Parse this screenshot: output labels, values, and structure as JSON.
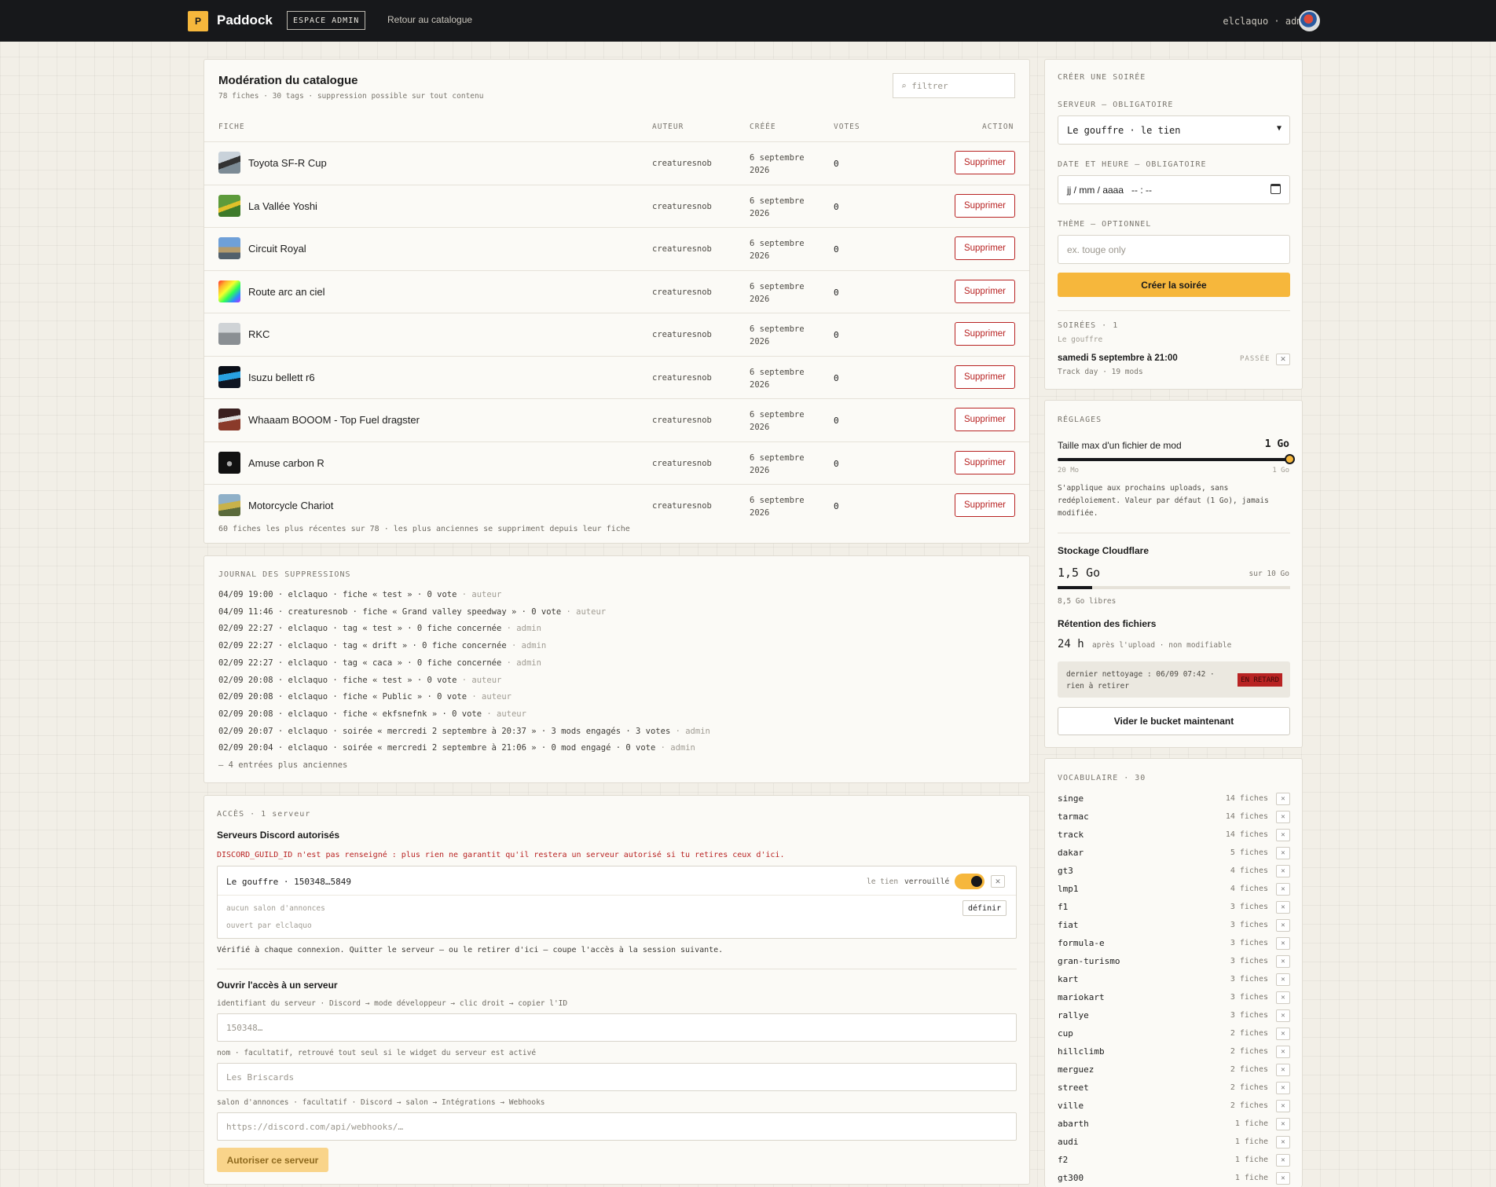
{
  "topbar": {
    "logo_letter": "P",
    "brand": "Paddock",
    "admin_badge": "ESPACE ADMIN",
    "back_link": "Retour au catalogue",
    "user": "elclaquo · admin"
  },
  "moderation": {
    "title": "Modération du catalogue",
    "subtitle": "78 fiches · 30 tags · suppression possible sur tout contenu",
    "filter_placeholder": "⌕ filtrer",
    "headers": {
      "fiche": "FICHE",
      "auteur": "AUTEUR",
      "creee": "CRÉÉE",
      "votes": "VOTES",
      "action": "ACTION"
    },
    "delete_label": "Supprimer",
    "rows": [
      {
        "name": "Toyota SF-R Cup",
        "author": "creaturesnob",
        "date1": "6 septembre",
        "date2": "2026",
        "votes": "0"
      },
      {
        "name": "La Vallée Yoshi",
        "author": "creaturesnob",
        "date1": "6 septembre",
        "date2": "2026",
        "votes": "0"
      },
      {
        "name": "Circuit Royal",
        "author": "creaturesnob",
        "date1": "6 septembre",
        "date2": "2026",
        "votes": "0"
      },
      {
        "name": "Route arc an ciel",
        "author": "creaturesnob",
        "date1": "6 septembre",
        "date2": "2026",
        "votes": "0"
      },
      {
        "name": "RKC",
        "author": "creaturesnob",
        "date1": "6 septembre",
        "date2": "2026",
        "votes": "0"
      },
      {
        "name": "Isuzu bellett r6",
        "author": "creaturesnob",
        "date1": "6 septembre",
        "date2": "2026",
        "votes": "0"
      },
      {
        "name": "Whaaam BOOOM - Top Fuel dragster",
        "author": "creaturesnob",
        "date1": "6 septembre",
        "date2": "2026",
        "votes": "0"
      },
      {
        "name": "Amuse carbon R",
        "author": "creaturesnob",
        "date1": "6 septembre",
        "date2": "2026",
        "votes": "0"
      },
      {
        "name": "Motorcycle Chariot",
        "author": "creaturesnob",
        "date1": "6 septembre",
        "date2": "2026",
        "votes": "0"
      }
    ],
    "footer": "60 fiches les plus récentes sur 78 · les plus anciennes se suppriment depuis leur fiche"
  },
  "journal": {
    "title": "JOURNAL DES SUPPRESSIONS",
    "entries": [
      {
        "text": "04/09 19:00 · elclaquo · fiche « test » · 0 vote",
        "tag": "· auteur"
      },
      {
        "text": "04/09 11:46 · creaturesnob · fiche « Grand valley speedway » · 0 vote",
        "tag": "· auteur"
      },
      {
        "text": "02/09 22:27 · elclaquo · tag « test » · 0 fiche concernée",
        "tag": "· admin"
      },
      {
        "text": "02/09 22:27 · elclaquo · tag « drift » · 0 fiche concernée",
        "tag": "· admin"
      },
      {
        "text": "02/09 22:27 · elclaquo · tag « caca » · 0 fiche concernée",
        "tag": "· admin"
      },
      {
        "text": "02/09 20:08 · elclaquo · fiche « test » · 0 vote",
        "tag": "· auteur"
      },
      {
        "text": "02/09 20:08 · elclaquo · fiche « Public » · 0 vote",
        "tag": "· auteur"
      },
      {
        "text": "02/09 20:08 · elclaquo · fiche « ekfsnefnk » · 0 vote",
        "tag": "· auteur"
      },
      {
        "text": "02/09 20:07 · elclaquo · soirée « mercredi 2 septembre à 20:37 » · 3 mods engagés · 3 votes",
        "tag": "· admin"
      },
      {
        "text": "02/09 20:04 · elclaquo · soirée « mercredi 2 septembre à 21:06 » · 0 mod engagé · 0 vote",
        "tag": "· admin"
      }
    ],
    "more": "— 4 entrées plus anciennes"
  },
  "access": {
    "title": "ACCÈS · 1 serveur",
    "servers_heading": "Serveurs Discord autorisés",
    "warning": "DISCORD_GUILD_ID n'est pas renseigné : plus rien ne garantit qu'il restera un serveur autorisé si tu retires ceux d'ici.",
    "server_name": "Le gouffre · 150348…5849",
    "server_owner": "le tien",
    "server_locked": "verrouillé",
    "server_no_channel": "aucun salon d'annonces",
    "server_define": "définir",
    "server_opened_by": "ouvert par elclaquo",
    "verify_note": "Vérifié à chaque connexion. Quitter le serveur — ou le retirer d'ici — coupe l'accès à la session suivante.",
    "open_heading": "Ouvrir l'accès à un serveur",
    "id_hint": "identifiant du serveur · Discord → mode développeur → clic droit → copier l'ID",
    "id_placeholder": "150348…",
    "name_hint": "nom · facultatif, retrouvé tout seul si le widget du serveur est activé",
    "name_placeholder": "Les Briscards",
    "webhook_hint": "salon d'annonces · facultatif · Discord → salon → Intégrations → Webhooks",
    "webhook_placeholder": "https://discord.com/api/webhooks/…",
    "authorize_button": "Autoriser ce serveur"
  },
  "create_event": {
    "title": "CRÉER UNE SOIRÉE",
    "server_label": "SERVEUR — OBLIGATOIRE",
    "server_value": "Le gouffre · le tien",
    "date_label": "DATE ET HEURE — OBLIGATOIRE",
    "date_value": "jj / mm / aaaa   -- : --",
    "theme_label": "THÈME — OPTIONNEL",
    "theme_placeholder": "ex. touge only",
    "create_button": "Créer la soirée",
    "soirees_label": "SOIRÉES · 1",
    "soiree_server": "Le gouffre",
    "soiree_date": "samedi 5 septembre à 21:00",
    "soiree_status": "PASSÉE",
    "soiree_meta": "Track day · 19 mods"
  },
  "settings": {
    "title": "RÉGLAGES",
    "max_size_label": "Taille max d'un fichier de mod",
    "max_size_value": "1 Go",
    "slider_fraction": 1.0,
    "slider_min": "20 Mo",
    "slider_max": "1 Go",
    "slider_note": "S'applique aux prochains uploads, sans redéploiement. Valeur par défaut (1 Go), jamais modifiée.",
    "storage_heading": "Stockage Cloudflare",
    "storage_used": "1,5 Go",
    "storage_total": "sur 10 Go",
    "storage_fraction": 0.15,
    "storage_free": "8,5 Go libres",
    "retention_heading": "Rétention des fichiers",
    "retention_value": "24 h",
    "retention_note": "après l'upload · non modifiable",
    "cleanup_text": "dernier nettoyage : 06/09 07:42 · rien à retirer",
    "cleanup_badge": "EN RETARD",
    "empty_button": "Vider le bucket maintenant"
  },
  "vocab": {
    "title": "VOCABULAIRE · 30",
    "items": [
      {
        "name": "singe",
        "count": "14 fiches"
      },
      {
        "name": "tarmac",
        "count": "14 fiches"
      },
      {
        "name": "track",
        "count": "14 fiches"
      },
      {
        "name": "dakar",
        "count": "5 fiches"
      },
      {
        "name": "gt3",
        "count": "4 fiches"
      },
      {
        "name": "lmp1",
        "count": "4 fiches"
      },
      {
        "name": "f1",
        "count": "3 fiches"
      },
      {
        "name": "fiat",
        "count": "3 fiches"
      },
      {
        "name": "formula-e",
        "count": "3 fiches"
      },
      {
        "name": "gran-turismo",
        "count": "3 fiches"
      },
      {
        "name": "kart",
        "count": "3 fiches"
      },
      {
        "name": "mariokart",
        "count": "3 fiches"
      },
      {
        "name": "rallye",
        "count": "3 fiches"
      },
      {
        "name": "cup",
        "count": "2 fiches"
      },
      {
        "name": "hillclimb",
        "count": "2 fiches"
      },
      {
        "name": "merguez",
        "count": "2 fiches"
      },
      {
        "name": "street",
        "count": "2 fiches"
      },
      {
        "name": "ville",
        "count": "2 fiches"
      },
      {
        "name": "abarth",
        "count": "1 fiche"
      },
      {
        "name": "audi",
        "count": "1 fiche"
      },
      {
        "name": "f2",
        "count": "1 fiche"
      },
      {
        "name": "gt300",
        "count": "1 fiche"
      }
    ]
  },
  "colors": {
    "accent": "#f6b73c",
    "danger": "#b82323",
    "topbar": "#17181b"
  }
}
